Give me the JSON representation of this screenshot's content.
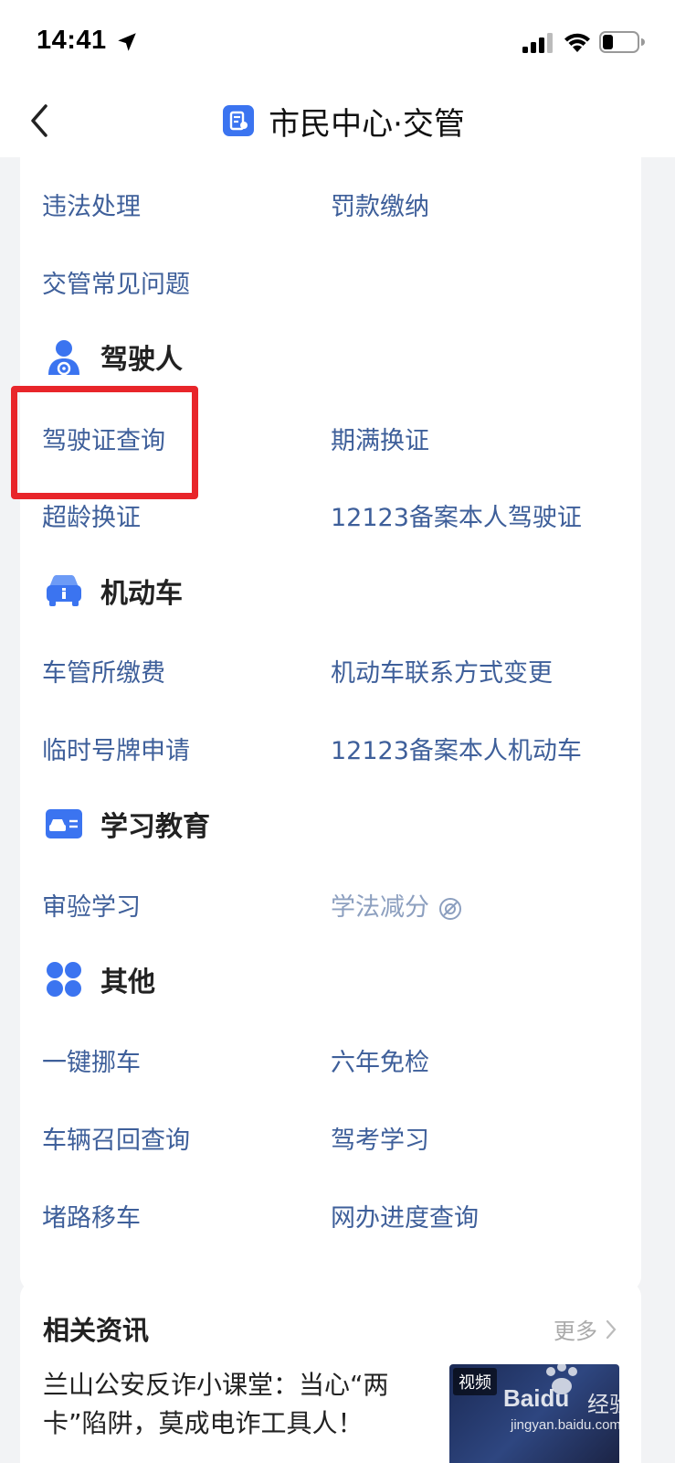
{
  "status": {
    "time": "14:41"
  },
  "nav": {
    "title": "市民中心·交管"
  },
  "sections": {
    "top": {
      "items": [
        "违法处理",
        "罚款缴纳",
        "交管常见问题"
      ]
    },
    "driver": {
      "title": "驾驶人",
      "items": [
        "驾驶证查询",
        "期满换证",
        "超龄换证",
        "12123备案本人驾驶证"
      ]
    },
    "vehicle": {
      "title": "机动车",
      "items": [
        "车管所缴费",
        "机动车联系方式变更",
        "临时号牌申请",
        "12123备案本人机动车"
      ]
    },
    "study": {
      "title": "学习教育",
      "items": [
        "审验学习",
        "学法减分"
      ]
    },
    "other": {
      "title": "其他",
      "items": [
        "一键挪车",
        "六年免检",
        "车辆召回查询",
        "驾考学习",
        "堵路移车",
        "网办进度查询"
      ]
    }
  },
  "news": {
    "title": "相关资讯",
    "more": "更多",
    "headline": "兰山公安反诈小课堂：当心“两卡”陷阱，莫成电诈工具人！",
    "thumb_tag": "视频"
  },
  "watermark": {
    "brand": "Baidu",
    "brand_cn": "经验",
    "url": "jingyan.baidu.com"
  },
  "colors": {
    "link": "#3e5f9a",
    "accent": "#3b74f0",
    "highlight": "#e8252a"
  },
  "icons": {
    "status": [
      "location-arrow-icon",
      "cellular-signal-icon",
      "wifi-icon",
      "battery-icon"
    ],
    "sections": [
      "driver-person-icon",
      "car-icon",
      "id-card-icon",
      "four-circles-icon"
    ]
  }
}
